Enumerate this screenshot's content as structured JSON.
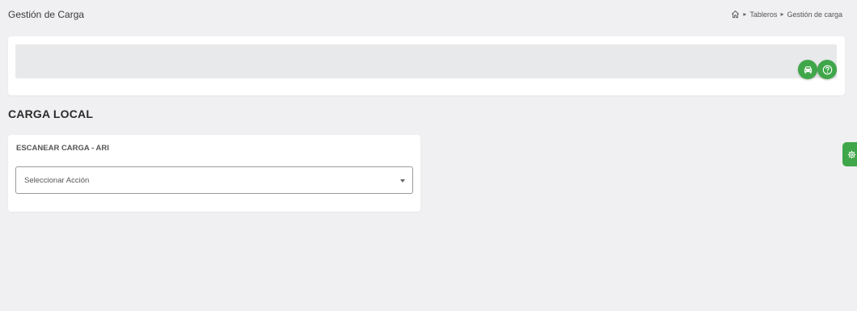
{
  "header": {
    "title": "Gestión de Carga",
    "breadcrumb": [
      {
        "label": "Tableros"
      },
      {
        "label": "Gestión de carga"
      }
    ]
  },
  "toolbar": {
    "buttons": [
      {
        "icon": "car-icon"
      },
      {
        "icon": "help-circle-icon"
      }
    ]
  },
  "section": {
    "title": "CARGA LOCAL"
  },
  "scan_card": {
    "title": "ESCANEAR CARGA - ARI",
    "select": {
      "value": "Seleccionar Acción"
    }
  },
  "settings_tab": {
    "icon": "gear-icon"
  },
  "colors": {
    "accent": "#3fa74a",
    "background": "#f0f0f2",
    "card": "#ffffff",
    "bar": "#e8e9eb"
  }
}
